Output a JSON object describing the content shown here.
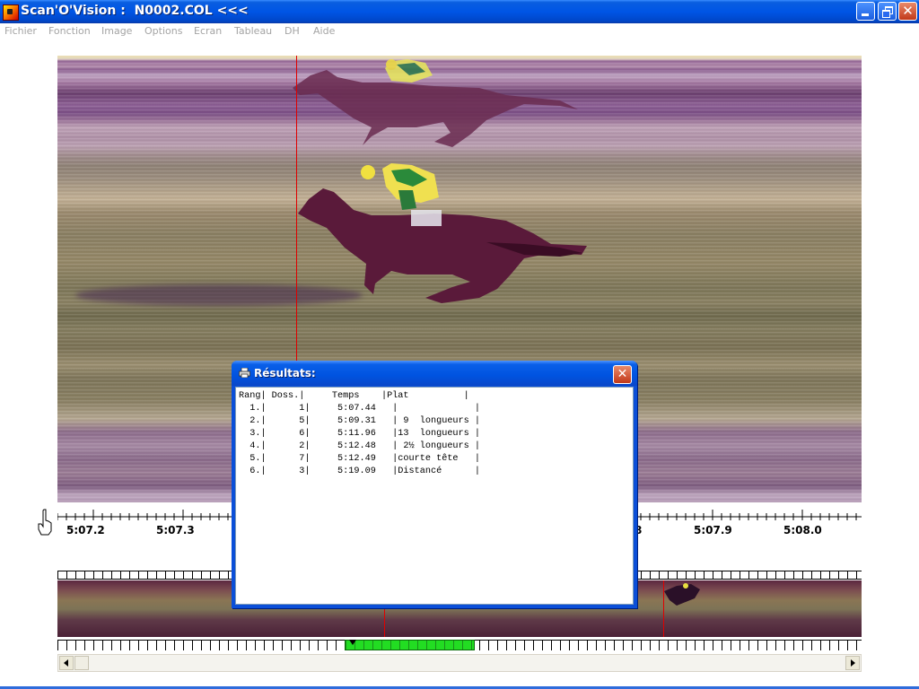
{
  "window": {
    "title": "Scan'O'Vision :  N0002.COL <<<"
  },
  "menu": [
    "Fichier",
    "Fonction",
    "Image",
    "Options",
    "Ecran",
    "Tableau",
    "DH",
    "Aide"
  ],
  "ruler": {
    "labels_visible": [
      "5:07.2",
      "5:07.3",
      "5:07.9",
      "5:08.0"
    ],
    "partial_label": "8"
  },
  "dialog": {
    "title": "Résultats:",
    "columns": "Rang| Doss.|     Temps    |Plat          |",
    "rows": [
      "  1.|      1|     5:07.44   |              |",
      "  2.|      5|     5:09.31   | 9  longueurs |",
      "  3.|      6|     5:11.96   |13  longueurs |",
      "  4.|      2|     5:12.48   | 2½ longueurs |",
      "  5.|      7|     5:12.49   |courte tête   |",
      "  6.|      3|     5:19.09   |Distancé      |"
    ]
  }
}
